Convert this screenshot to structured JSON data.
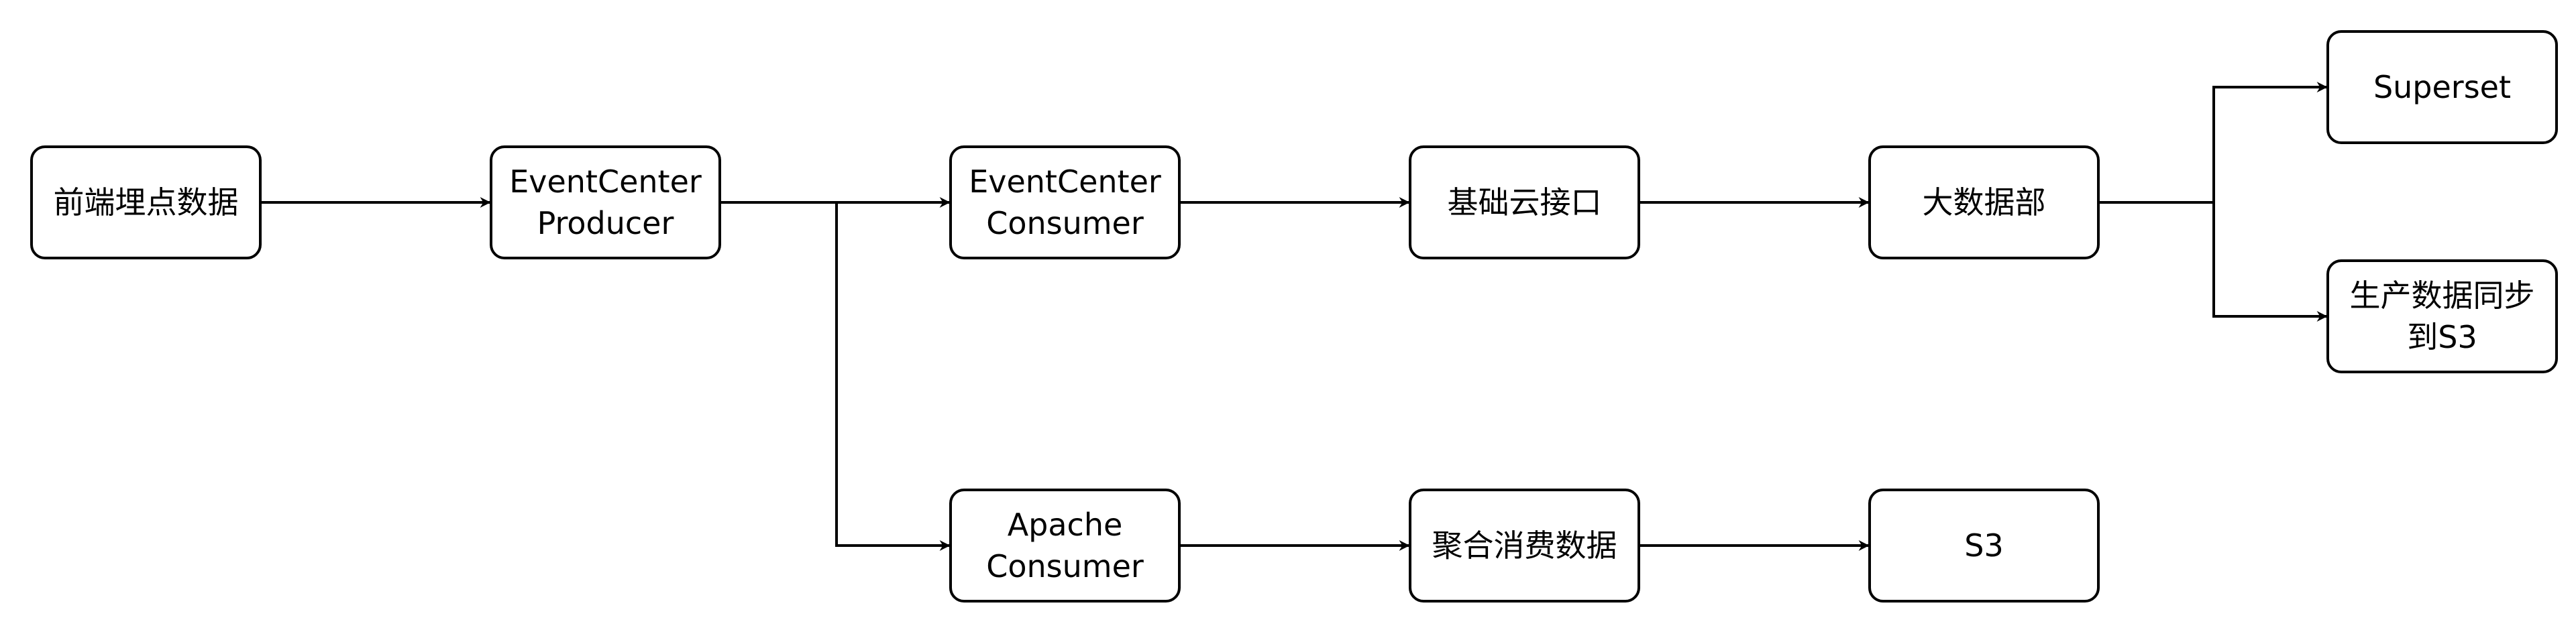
{
  "diagram": {
    "colors": {
      "stroke": "#000000",
      "fill": "#ffffff",
      "text": "#000000"
    },
    "nodes": {
      "frontend": "前端埋点数据",
      "producer": "EventCenter\nProducer",
      "consumer": "EventCenter\nConsumer",
      "cloud_api": "基础云接口",
      "bigdata": "大数据部",
      "superset": "Superset",
      "sync_s3": "生产数据同步\n到S3",
      "apache_consumer": "Apache\nConsumer",
      "aggregate": "聚合消费数据",
      "s3": "S3"
    },
    "edges": [
      {
        "from": "frontend",
        "to": "producer"
      },
      {
        "from": "producer",
        "to": "consumer"
      },
      {
        "from": "producer",
        "to": "apache_consumer"
      },
      {
        "from": "consumer",
        "to": "cloud_api"
      },
      {
        "from": "cloud_api",
        "to": "bigdata"
      },
      {
        "from": "bigdata",
        "to": "superset"
      },
      {
        "from": "bigdata",
        "to": "sync_s3"
      },
      {
        "from": "apache_consumer",
        "to": "aggregate"
      },
      {
        "from": "aggregate",
        "to": "s3"
      }
    ]
  }
}
